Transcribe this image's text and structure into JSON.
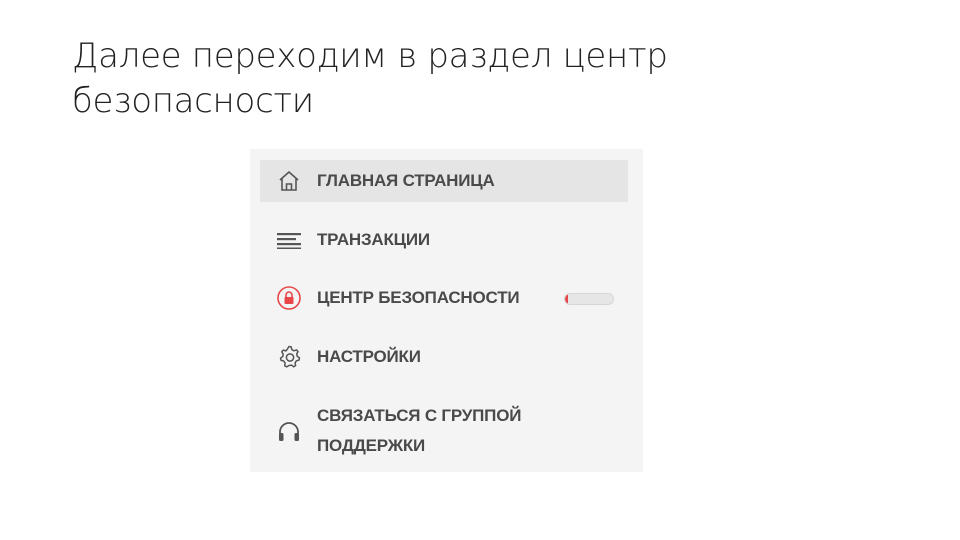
{
  "slide": {
    "title_line1": "Далее переходим в раздел центр",
    "title_line2": "безопасности"
  },
  "menu": {
    "items": [
      {
        "label": "ГЛАВНАЯ СТРАНИЦА",
        "icon": "home-icon",
        "active": true
      },
      {
        "label": "ТРАНЗАКЦИИ",
        "icon": "list-icon",
        "active": false
      },
      {
        "label": "ЦЕНТР БЕЗОПАСНОСТИ",
        "icon": "lock-icon",
        "active": false,
        "security_level": 0.06
      },
      {
        "label": "НАСТРОЙКИ",
        "icon": "gear-icon",
        "active": false
      },
      {
        "label_line1": "СВЯЗАТЬСЯ С ГРУППОЙ",
        "label_line2": "ПОДДЕРЖКИ",
        "icon": "headset-icon",
        "active": false
      }
    ]
  },
  "colors": {
    "panel_bg": "#f4f4f4",
    "active_bg": "#e5e5e5",
    "label": "#4a4a4a",
    "security_accent": "#e8474a"
  }
}
